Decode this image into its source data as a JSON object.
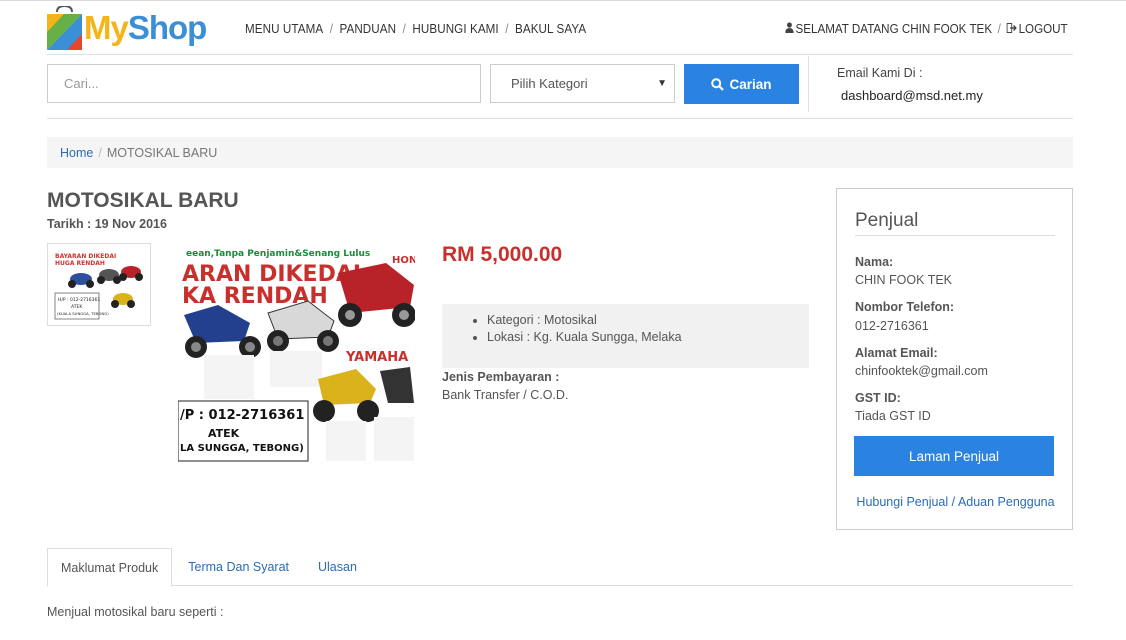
{
  "brand": {
    "logo_my": "My",
    "logo_shop": "Shop",
    "logo_colors": [
      "#f4b41a",
      "#4caf50",
      "#3a8fd6",
      "#e6452e"
    ]
  },
  "nav": {
    "items": [
      {
        "label": "MENU UTAMA"
      },
      {
        "label": "PANDUAN"
      },
      {
        "label": "HUBUNGI KAMI"
      },
      {
        "label": "BAKUL SAYA"
      }
    ],
    "separator": "/"
  },
  "user": {
    "welcome": "SELAMAT DATANG CHIN FOOK TEK",
    "logout": "LOGOUT",
    "user_icon": "user-icon",
    "logout_icon": "logout-icon"
  },
  "search": {
    "placeholder": "Cari...",
    "category": "Pilih Kategori",
    "button": "Carian",
    "button_icon": "search-icon"
  },
  "contact": {
    "label": "Email Kami Di :",
    "email": "dashboard@msd.net.my"
  },
  "breadcrumb": {
    "home": "Home",
    "separator": "/",
    "current": "MOTOSIKAL BARU"
  },
  "product": {
    "title": "MOTOSIKAL BARU",
    "date": "Tarikh : 19 Nov 2016",
    "price": "RM 5,000.00",
    "details": [
      "Kategori : Motosikal",
      "Lokasi : Kg. Kuala Sungga, Melaka"
    ],
    "payment_label": "Jenis Pembayaran :",
    "payment_value": "Bank Transfer / C.O.D.",
    "image_text": {
      "banner_1": "eean,Tanpa Penjamin&Senang Lulus",
      "banner_2": "ARAN DIKEDAI",
      "banner_3": "KA RENDAH",
      "brand_1": "HONDA",
      "brand_2": "YAMAHA",
      "phone": "/P : 012-2716361",
      "name": "ATEK",
      "address": "LA SUNGGA, TEBONG)"
    },
    "thumb_text": {
      "line_1": "BAYARAN DIKEDAI",
      "line_2": "HUGA RENDAH",
      "line_3": "H/P : 012-2716361",
      "line_4": "ATEK",
      "line_5": "(KUALA SUNGGA, TEBONG)"
    }
  },
  "seller": {
    "title": "Penjual",
    "fields": [
      {
        "label": "Nama:",
        "value": "CHIN FOOK TEK"
      },
      {
        "label": "Nombor Telefon:",
        "value": "012-2716361"
      },
      {
        "label": "Alamat Email:",
        "value": "chinfooktek@gmail.com"
      },
      {
        "label": "GST ID:",
        "value": "Tiada GST ID"
      }
    ],
    "button": "Laman Penjual",
    "link_contact": "Hubungi Penjual",
    "link_separator": "/",
    "link_report": "Aduan Pengguna"
  },
  "tabs": [
    {
      "label": "Maklumat Produk",
      "active": true
    },
    {
      "label": "Terma Dan Syarat",
      "active": false
    },
    {
      "label": "Ulasan",
      "active": false
    }
  ],
  "description": "Menjual motosikal baru seperti :",
  "colors": {
    "accent": "#2a83e0",
    "price": "#c9302c",
    "link": "#2a6bb7"
  }
}
